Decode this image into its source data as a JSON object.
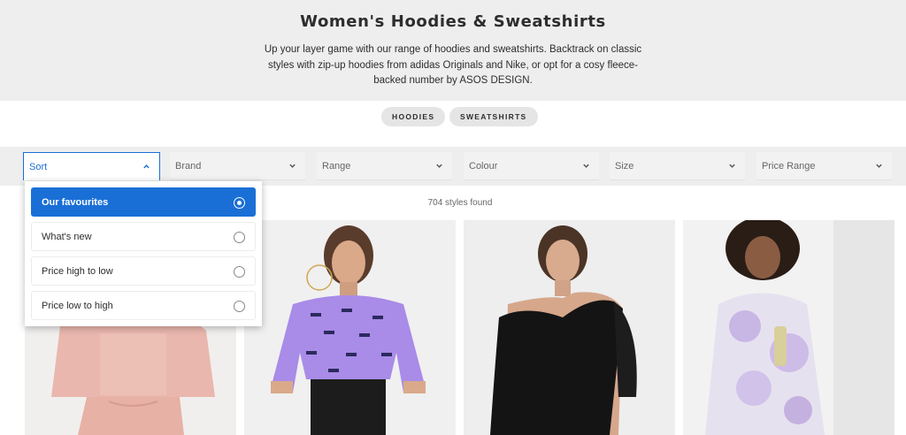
{
  "hero": {
    "title": "Women's Hoodies & Sweatshirts",
    "description": "Up your layer game with our range of hoodies and sweatshirts. Backtrack on classic styles with zip-up hoodies from adidas Originals and Nike, or opt for a cosy fleece-backed number by ASOS DESIGN."
  },
  "chips": [
    {
      "label": "HOODIES"
    },
    {
      "label": "SWEATSHIRTS"
    }
  ],
  "filters": [
    {
      "label": "Sort",
      "icon": "chevron-up-icon"
    },
    {
      "label": "Brand",
      "icon": "chevron-down-icon"
    },
    {
      "label": "Range",
      "icon": "chevron-down-icon"
    },
    {
      "label": "Colour",
      "icon": "chevron-down-icon"
    },
    {
      "label": "Size",
      "icon": "chevron-down-icon"
    },
    {
      "label": "Price Range",
      "icon": "chevron-down-icon"
    }
  ],
  "results": {
    "count_text": "704 styles found"
  },
  "sort_options": [
    {
      "label": "Our favourites",
      "selected": true
    },
    {
      "label": "What's new",
      "selected": false
    },
    {
      "label": "Price high to low",
      "selected": false
    },
    {
      "label": "Price low to high",
      "selected": false
    }
  ],
  "products": [
    {
      "image": "pink-hoodie-product-image"
    },
    {
      "image": "lilac-printed-cropped-sweatshirt-product-image"
    },
    {
      "image": "black-one-shoulder-sweatshirt-product-image"
    },
    {
      "image": "lilac-tie-dye-hoodie-product-image"
    }
  ],
  "colors": {
    "accent": "#1a6fd6",
    "hero_bg": "#eeeeee",
    "chip_bg": "#e5e5e5",
    "text": "#2d2d2d"
  }
}
